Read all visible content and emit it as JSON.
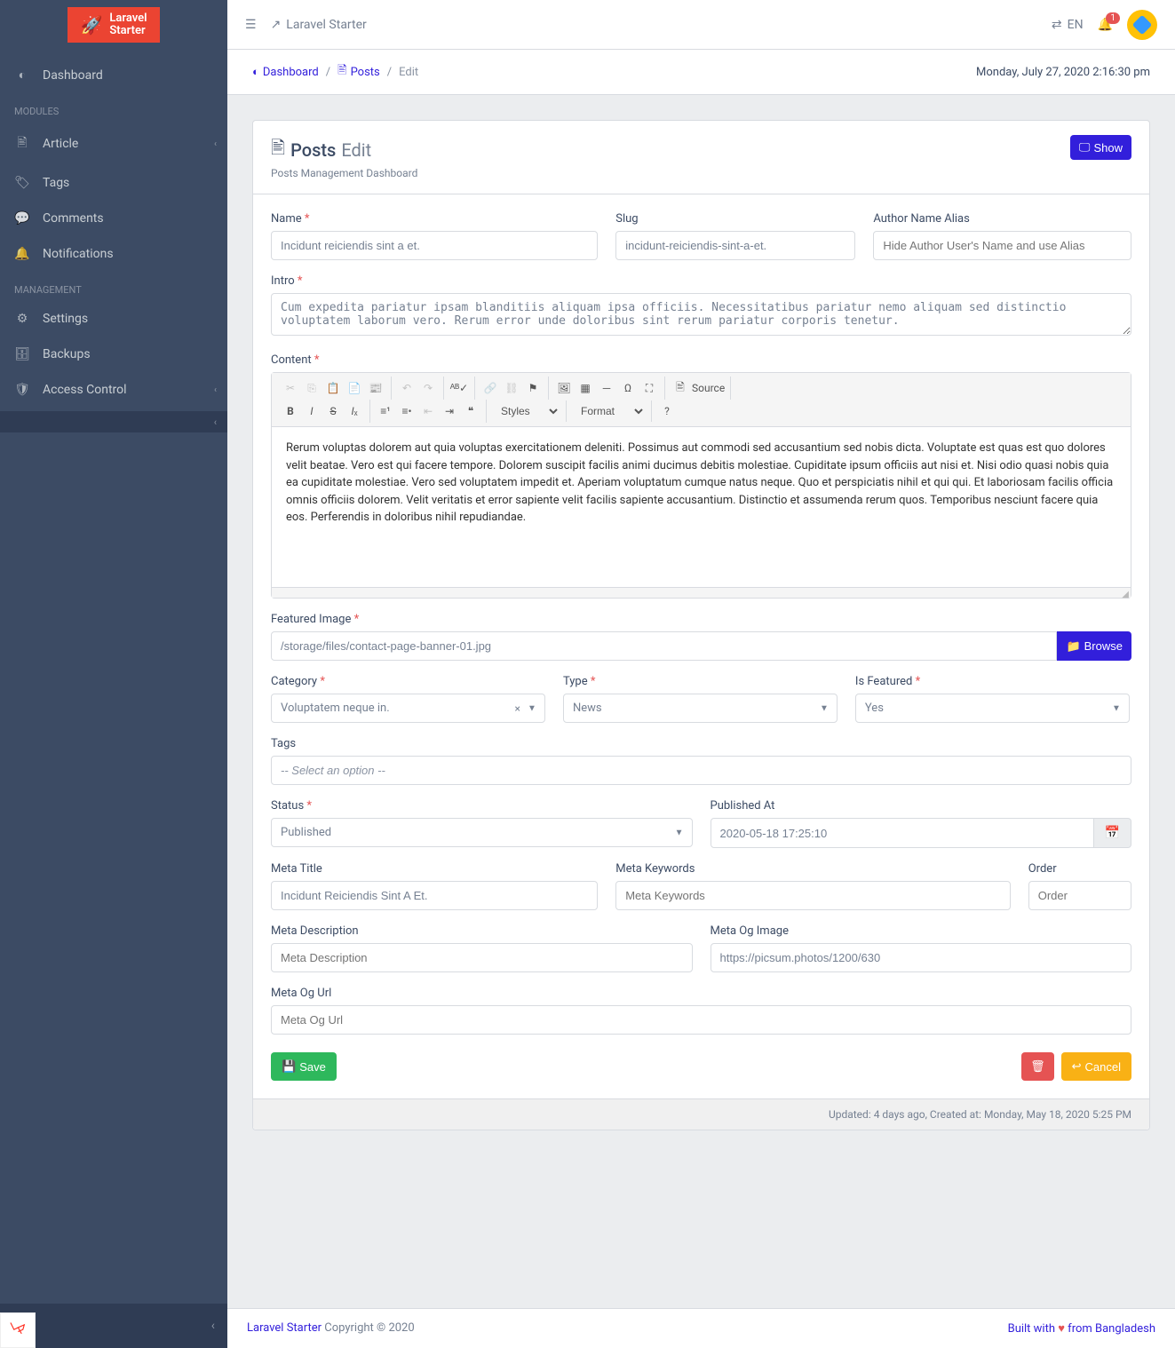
{
  "brand": {
    "line1": "Laravel",
    "line2": "Starter"
  },
  "sidebar": {
    "dashboard": "Dashboard",
    "modules_title": "MODULES",
    "management_title": "MANAGEMENT",
    "items": {
      "article": "Article",
      "tags": "Tags",
      "comments": "Comments",
      "notifications": "Notifications",
      "settings": "Settings",
      "backups": "Backups",
      "access": "Access Control"
    }
  },
  "header": {
    "app_link": "Laravel Starter",
    "lang": "EN",
    "notif_count": "1"
  },
  "breadcrumb": {
    "dashboard": "Dashboard",
    "posts": "Posts",
    "edit": "Edit",
    "datetime": "Monday, July 27, 2020 2:16:30 pm"
  },
  "card": {
    "icon_title": "Posts",
    "subtitle_inline": "Edit",
    "subtitle": "Posts Management Dashboard",
    "show_btn": "Show"
  },
  "labels": {
    "name": "Name",
    "slug": "Slug",
    "author": "Author Name Alias",
    "intro": "Intro",
    "content": "Content",
    "featured_image": "Featured Image",
    "category": "Category",
    "type": "Type",
    "is_featured": "Is Featured",
    "tags": "Tags",
    "status": "Status",
    "published_at": "Published At",
    "meta_title": "Meta Title",
    "meta_keywords": "Meta Keywords",
    "order": "Order",
    "meta_description": "Meta Description",
    "meta_og_image": "Meta Og Image",
    "meta_og_url": "Meta Og Url"
  },
  "values": {
    "name": "Incidunt reiciendis sint a et.",
    "slug": "incidunt-reiciendis-sint-a-et.",
    "intro": "Cum expedita pariatur ipsam blanditiis aliquam ipsa officiis. Necessitatibus pariatur nemo aliquam sed distinctio voluptatem laborum vero. Rerum error unde doloribus sint rerum pariatur corporis tenetur.",
    "content": "Rerum voluptas dolorem aut quia voluptas exercitationem deleniti. Possimus aut commodi sed accusantium sed nobis dicta. Voluptate est quas est quo dolores velit beatae. Vero est qui facere tempore. Dolorem suscipit facilis animi ducimus debitis molestiae. Cupiditate ipsum officiis aut nisi et. Nisi odio quasi nobis quia ea cupiditate molestiae. Vero sed voluptatem impedit et. Aperiam voluptatum cumque natus neque. Quo et perspiciatis nihil et qui qui. Et laboriosam facilis officia omnis officiis dolorem. Velit veritatis et error sapiente velit facilis sapiente accusantium. Distinctio et assumenda rerum quos. Temporibus nesciunt facere quia eos. Perferendis in doloribus nihil repudiandae.",
    "featured_image": "/storage/files/contact-page-banner-01.jpg",
    "category": "Voluptatem neque in.",
    "type": "News",
    "is_featured": "Yes",
    "tags_placeholder": "-- Select an option --",
    "status": "Published",
    "published_at": "2020-05-18 17:25:10",
    "meta_title": "Incidunt Reiciendis Sint A Et.",
    "meta_og_image": "https://picsum.photos/1200/630"
  },
  "placeholders": {
    "author": "Hide Author User's Name and use Alias",
    "meta_keywords": "Meta Keywords",
    "order": "Order",
    "meta_description": "Meta Description",
    "meta_og_url": "Meta Og Url"
  },
  "editor_toolbar": {
    "source": "Source",
    "styles": "Styles",
    "format": "Format"
  },
  "buttons": {
    "browse": "Browse",
    "save": "Save",
    "cancel": "Cancel"
  },
  "card_footer": "Updated: 4 days ago, Created at: Monday, May 18, 2020 5:25 PM",
  "footer": {
    "left_link": "Laravel Starter",
    "left_text": " Copyright © 2020",
    "right_prefix": "Built with ",
    "right_suffix": " from Bangladesh"
  }
}
